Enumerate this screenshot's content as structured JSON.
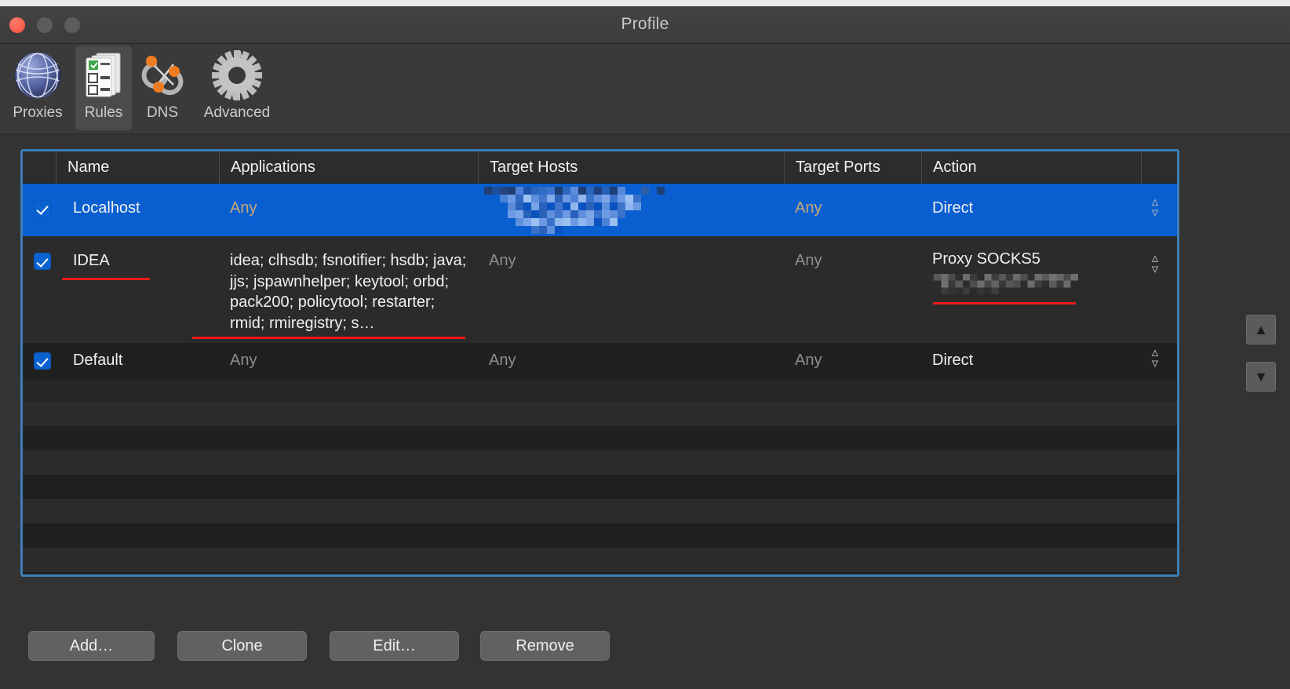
{
  "window": {
    "title": "Profile",
    "traffic_lights": [
      "close",
      "minimize",
      "maximize"
    ]
  },
  "toolbar": {
    "items": [
      {
        "id": "proxies",
        "label": "Proxies",
        "icon": "globe-icon",
        "selected": false
      },
      {
        "id": "rules",
        "label": "Rules",
        "icon": "checklist-icon",
        "selected": true
      },
      {
        "id": "dns",
        "label": "DNS",
        "icon": "network-icon",
        "selected": false
      },
      {
        "id": "advanced",
        "label": "Advanced",
        "icon": "gear-icon",
        "selected": false
      }
    ]
  },
  "table": {
    "columns": [
      {
        "key": "name",
        "label": "Name"
      },
      {
        "key": "applications",
        "label": "Applications"
      },
      {
        "key": "target_hosts",
        "label": "Target Hosts"
      },
      {
        "key": "target_ports",
        "label": "Target Ports"
      },
      {
        "key": "action",
        "label": "Action"
      }
    ],
    "rows": [
      {
        "enabled": true,
        "name": "Localhost",
        "applications": "Any",
        "target_hosts": "",
        "target_hosts_redacted": true,
        "target_ports": "Any",
        "action": "Direct",
        "action_redacted": false,
        "selected": true,
        "underline_name": false,
        "underline_applications": false,
        "underline_action": false
      },
      {
        "enabled": true,
        "name": "IDEA",
        "applications": "idea; clhsdb; fsnotifier; hsdb; java; jjs; jspawnhelper; keytool; orbd; pack200; policytool; restarter; rmid; rmiregistry; s…",
        "target_hosts": "Any",
        "target_hosts_redacted": false,
        "target_ports": "Any",
        "action": "Proxy SOCKS5",
        "action_redacted": true,
        "selected": false,
        "underline_name": true,
        "underline_applications": true,
        "underline_action": true
      },
      {
        "enabled": true,
        "name": "Default",
        "applications": "Any",
        "target_hosts": "Any",
        "target_hosts_redacted": false,
        "target_ports": "Any",
        "action": "Direct",
        "action_redacted": false,
        "selected": false,
        "underline_name": false,
        "underline_applications": false,
        "underline_action": false
      }
    ]
  },
  "side_controls": {
    "move_up_label": "▲",
    "move_down_label": "▼"
  },
  "buttons": [
    {
      "id": "add",
      "label": "Add…"
    },
    {
      "id": "clone",
      "label": "Clone"
    },
    {
      "id": "edit",
      "label": "Edit…"
    },
    {
      "id": "remove",
      "label": "Remove"
    }
  ],
  "colors": {
    "selection_blue": "#0a5fd0",
    "frame_blue": "#3d7fb5",
    "annotation_red": "#f51919",
    "window_bg": "#333333",
    "muted_text": "#8e8e8e"
  }
}
